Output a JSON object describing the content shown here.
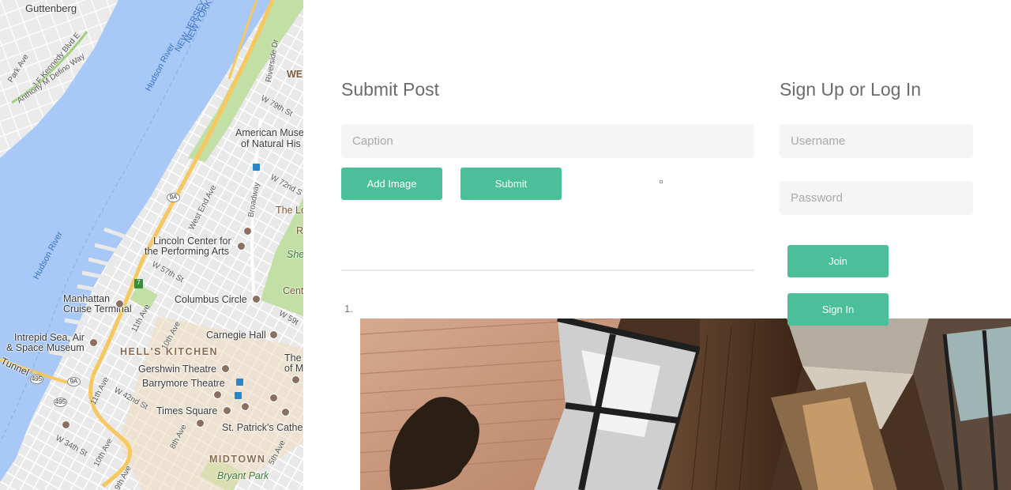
{
  "map": {
    "labels": {
      "guttenberg": "Guttenberg",
      "park_ave": "Park Ave",
      "jfk_blvd": "J F Kennedy Blvd E",
      "anthony_defino": "Anthony M Defino Way",
      "new_jersey": "NEW JERSEY",
      "new_york": "NEW YORK",
      "hudson_river_top": "Hudson River",
      "hudson_river_left": "Hudson River",
      "riverside_dr": "Riverside Dr",
      "we_cut": "WE",
      "w79": "W 79th St",
      "amnh_1": "American Muse",
      "amnh_2": "of Natural His",
      "w72": "W 72nd S",
      "west_end_ave": "West End Ave",
      "broadway": "Broadway",
      "the_lo": "The Lo",
      "r_cut": "R",
      "lincoln_1": "Lincoln Center for",
      "lincoln_2": "the Performing Arts",
      "she_cut": "She",
      "w57": "W 57th St",
      "manhattan_ct_1": "Manhattan",
      "manhattan_ct_2": "Cruise Terminal",
      "columbus_circle": "Columbus Circle",
      "cent_cut": "Cent",
      "w59": "W 59t",
      "intrepid_1": "Intrepid Sea, Air",
      "intrepid_2": "& Space Museum",
      "ave_11": "11th Ave",
      "ave_10": "10th Ave",
      "carnegie_hall": "Carnegie Hall",
      "hells_kitchen": "HELL'S KITCHEN",
      "the_m_1": "The",
      "the_m_2": "of M",
      "tunnel": "Tunnel",
      "gershwin": "Gershwin Theatre",
      "barrymore": "Barrymore Theatre",
      "ave_11b": "11th Ave",
      "w42": "W 42nd St",
      "times_square": "Times Square",
      "st_patricks": "St. Patrick's Cathe",
      "w34": "W 34th St",
      "ave_10b": "10th Ave",
      "ave_8": "8th Ave",
      "ave_5": "5th Ave",
      "midtown": "MIDTOWN",
      "bryant_park": "Bryant Park",
      "ave_9": "9th Ave"
    },
    "shields": {
      "r9a_1": "9A",
      "r9a_2": "9A",
      "r495_1": "495",
      "r495_2": "495",
      "r9a_3": "9A",
      "route7": "7"
    }
  },
  "submit_post": {
    "title": "Submit Post",
    "caption_placeholder": "Caption",
    "add_image_label": "Add Image",
    "submit_label": "Submit",
    "list_marker": "1."
  },
  "auth": {
    "title": "Sign Up or Log In",
    "username_placeholder": "Username",
    "password_placeholder": "Password",
    "join_label": "Join",
    "sign_in_label": "Sign In"
  },
  "colors": {
    "accent": "#4bbf9a",
    "field_bg": "#f5f5f5",
    "heading": "#6b6b6b",
    "water": "#a8c8f8",
    "park": "#c2e0a5"
  }
}
